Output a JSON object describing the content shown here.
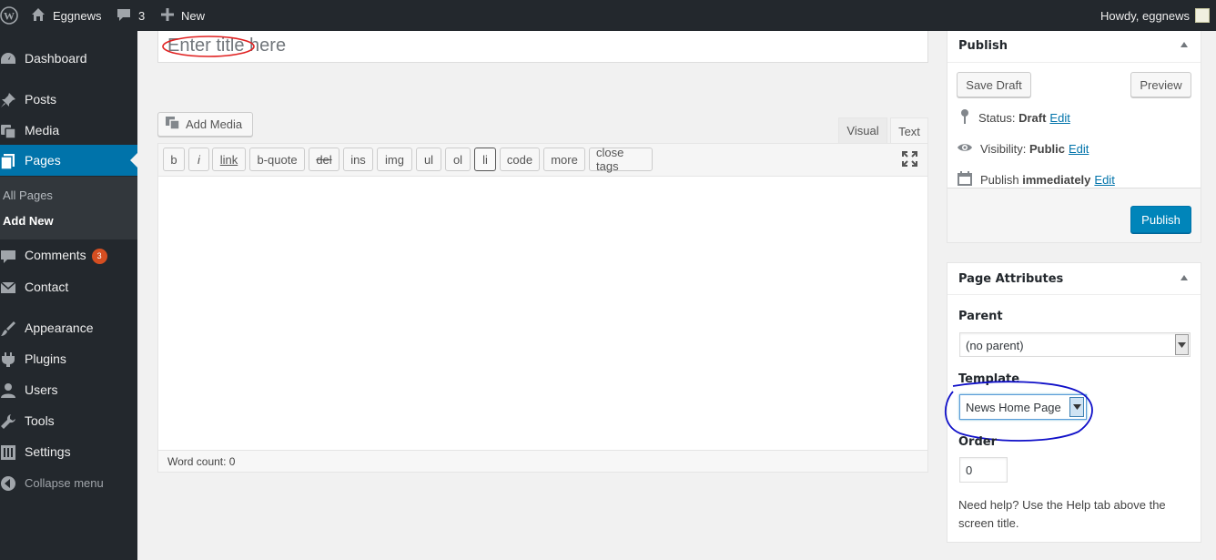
{
  "admin_bar": {
    "site_name": "Eggnews",
    "comments_count": "3",
    "new_label": "New",
    "howdy": "Howdy, eggnews"
  },
  "sidebar": {
    "items": [
      {
        "label": "Dashboard",
        "icon": "dashboard-icon"
      },
      {
        "label": "Posts",
        "icon": "pin-icon"
      },
      {
        "label": "Media",
        "icon": "media-icon"
      },
      {
        "label": "Pages",
        "icon": "pages-icon"
      },
      {
        "label": "Comments",
        "icon": "comment-icon",
        "badge": "3"
      },
      {
        "label": "Contact",
        "icon": "mail-icon"
      },
      {
        "label": "Appearance",
        "icon": "brush-icon"
      },
      {
        "label": "Plugins",
        "icon": "plugin-icon"
      },
      {
        "label": "Users",
        "icon": "user-icon"
      },
      {
        "label": "Tools",
        "icon": "wrench-icon"
      },
      {
        "label": "Settings",
        "icon": "settings-icon"
      },
      {
        "label": "Collapse menu",
        "icon": "collapse-icon"
      }
    ],
    "submenu": [
      "All Pages",
      "Add New"
    ],
    "active_color": "#0073aa"
  },
  "editor": {
    "title_placeholder": "Enter title here",
    "add_media": "Add Media",
    "tabs": [
      "Visual",
      "Text"
    ],
    "quicktags": [
      "b",
      "i",
      "link",
      "b-quote",
      "del",
      "ins",
      "img",
      "ul",
      "ol",
      "li",
      "code",
      "more",
      "close tags"
    ],
    "word_count": "Word count: 0"
  },
  "publish": {
    "heading": "Publish",
    "save_draft": "Save Draft",
    "preview": "Preview",
    "status_label": "Status: ",
    "status_value": "Draft",
    "visibility_label": "Visibility: ",
    "visibility_value": "Public",
    "publish_label": "Publish ",
    "publish_value": "immediately",
    "edit": "Edit",
    "publish_button": "Publish"
  },
  "attributes": {
    "heading": "Page Attributes",
    "parent_label": "Parent",
    "parent_value": "(no parent)",
    "template_label": "Template",
    "template_value": "News Home Page",
    "order_label": "Order",
    "order_value": "0",
    "help": "Need help? Use the Help tab above the screen title."
  },
  "annotations": {
    "red": "#e02020",
    "blue": "#1010c8"
  }
}
